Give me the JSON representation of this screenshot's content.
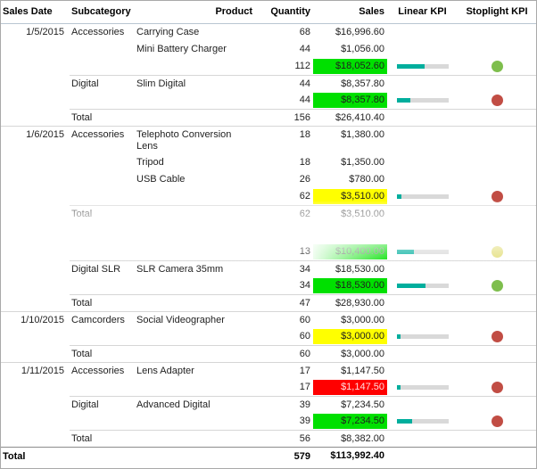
{
  "chart_data": {
    "type": "table",
    "columns": [
      "Sales Date",
      "Subcategory",
      "Product",
      "Quantity",
      "Sales",
      "Linear KPI",
      "Stoplight KPI"
    ],
    "rows": [
      {
        "date": "1/5/2015",
        "subcategory": "Accessories",
        "product": "Carrying Case",
        "quantity": "68",
        "sales": "$16,996.60"
      },
      {
        "product": "Mini Battery Charger",
        "quantity": "44",
        "sales": "$1,056.00"
      },
      {
        "quantity": "112",
        "sales": "$18,052.60",
        "sales_highlight": "green",
        "kpi_percent": 55,
        "stoplight": "green"
      },
      {
        "subcategory": "Digital",
        "product": "Slim Digital",
        "quantity": "44",
        "sales": "$8,357.80",
        "border": "group"
      },
      {
        "quantity": "44",
        "sales": "$8,357.80",
        "sales_highlight": "green",
        "kpi_percent": 27,
        "stoplight": "red"
      },
      {
        "subcategory": "Total",
        "quantity": "156",
        "sales": "$26,410.40",
        "border": "group"
      },
      {
        "date": "1/6/2015",
        "subcategory": "Accessories",
        "product": "Telephoto Conversion Lens",
        "quantity": "18",
        "sales": "$1,380.00",
        "border": "full",
        "tall": true
      },
      {
        "product": "Tripod",
        "quantity": "18",
        "sales": "$1,350.00"
      },
      {
        "product": "USB Cable",
        "quantity": "26",
        "sales": "$780.00"
      },
      {
        "quantity": "62",
        "sales": "$3,510.00",
        "sales_highlight": "yellow",
        "kpi_percent": 10,
        "stoplight": "red"
      },
      {
        "subcategory": "Total",
        "quantity": "62",
        "sales": "$3,510.00",
        "border": "group"
      },
      {
        "spacer": true
      },
      {
        "quantity": "13",
        "sales": "$10,400.00",
        "sales_highlight": "green_fade",
        "kpi_percent": 33,
        "stoplight": "yellow"
      },
      {
        "subcategory": "Digital SLR",
        "product": "SLR Camera 35mm",
        "quantity": "34",
        "sales": "$18,530.00",
        "border": "group"
      },
      {
        "quantity": "34",
        "sales": "$18,530.00",
        "sales_highlight": "green",
        "kpi_percent": 56,
        "stoplight": "green"
      },
      {
        "subcategory": "Total",
        "quantity": "47",
        "sales": "$28,930.00",
        "border": "group"
      },
      {
        "date": "1/10/2015",
        "subcategory": "Camcorders",
        "product": "Social Videographer",
        "quantity": "60",
        "sales": "$3,000.00",
        "border": "full"
      },
      {
        "quantity": "60",
        "sales": "$3,000.00",
        "sales_highlight": "yellow",
        "kpi_percent": 8,
        "stoplight": "red"
      },
      {
        "subcategory": "Total",
        "quantity": "60",
        "sales": "$3,000.00",
        "border": "group"
      },
      {
        "date": "1/11/2015",
        "subcategory": "Accessories",
        "product": "Lens Adapter",
        "quantity": "17",
        "sales": "$1,147.50",
        "border": "full"
      },
      {
        "quantity": "17",
        "sales": "$1,147.50",
        "sales_highlight": "red",
        "kpi_percent": 7,
        "stoplight": "red"
      },
      {
        "subcategory": "Digital",
        "product": "Advanced Digital",
        "quantity": "39",
        "sales": "$7,234.50",
        "border": "group"
      },
      {
        "quantity": "39",
        "sales": "$7,234.50",
        "sales_highlight": "green",
        "kpi_percent": 30,
        "stoplight": "red"
      },
      {
        "subcategory": "Total",
        "quantity": "56",
        "sales": "$8,382.00",
        "border": "group"
      }
    ],
    "grand_total": {
      "label": "Total",
      "quantity": "579",
      "sales": "$113,992.40"
    }
  },
  "colors": {
    "highlight_green": "#00e000",
    "highlight_yellow": "#ffff00",
    "highlight_red": "#ff0000",
    "red_cell_text": "#ffdede",
    "kpi_bar_teal": "#00ae9d",
    "kpi_track_gray": "#d9d9d9",
    "stoplight_green": "#7ebe4d",
    "stoplight_red": "#c14d44",
    "stoplight_yellow": "#e3de7a",
    "border_light": "#d6d6d6",
    "border_dark": "#8c8c8c"
  }
}
